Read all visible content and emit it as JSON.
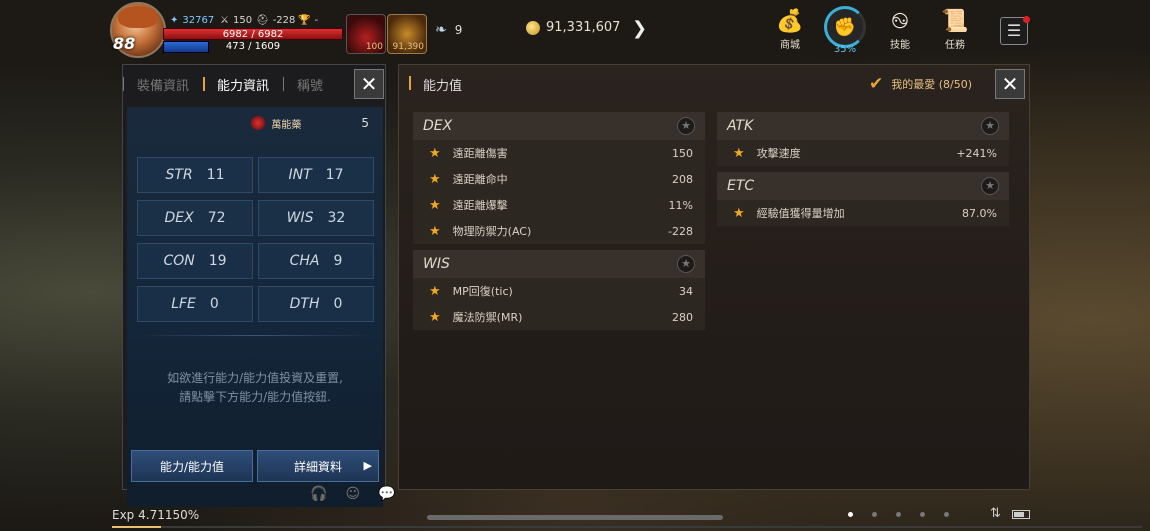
{
  "hud": {
    "level": "88",
    "wing_power": "32767",
    "stat_b": "150",
    "stat_c": "-228",
    "stat_d": "-",
    "hp": "6982 / 6982",
    "mp": "473 / 1609",
    "potion_count": "100",
    "feather_count": "91,390",
    "wing_count": "9",
    "gold": "91,331,607",
    "shop_label": "商城",
    "ring_percent": "35%",
    "skill_label": "技能",
    "quest_label": "任務"
  },
  "left_panel": {
    "tabs": [
      "裝備資訊",
      "能力資訊",
      "稱號"
    ],
    "elixir_label": "萬能藥",
    "elixir_count": "5",
    "stats": [
      {
        "name": "STR",
        "value": "11"
      },
      {
        "name": "INT",
        "value": "17"
      },
      {
        "name": "DEX",
        "value": "72"
      },
      {
        "name": "WIS",
        "value": "32"
      },
      {
        "name": "CON",
        "value": "19"
      },
      {
        "name": "CHA",
        "value": "9"
      },
      {
        "name": "LFE",
        "value": "0"
      },
      {
        "name": "DTH",
        "value": "0"
      }
    ],
    "hint_line1": "如欲進行能力/能力值投資及重置,",
    "hint_line2": "請點擊下方能力/能力值按鈕.",
    "btn_ability": "能力/能力值",
    "btn_detail": "詳細資料"
  },
  "right_panel": {
    "title": "能力值",
    "favorite": "我的最愛 (8/50)",
    "groups": {
      "dex": {
        "name": "DEX",
        "rows": [
          {
            "label": "遠距離傷害",
            "value": "150"
          },
          {
            "label": "遠距離命中",
            "value": "208"
          },
          {
            "label": "遠距離爆擊",
            "value": "11%"
          },
          {
            "label": "物理防禦力(AC)",
            "value": "-228"
          }
        ]
      },
      "wis": {
        "name": "WIS",
        "rows": [
          {
            "label": "MP回復(tic)",
            "value": "34"
          },
          {
            "label": "魔法防禦(MR)",
            "value": "280"
          }
        ]
      },
      "atk": {
        "name": "ATK",
        "rows": [
          {
            "label": "攻擊速度",
            "value": "+241%"
          }
        ]
      },
      "etc": {
        "name": "ETC",
        "rows": [
          {
            "label": "經驗值獲得量增加",
            "value": "87.0%"
          }
        ]
      }
    }
  },
  "bottom": {
    "exp": "Exp 4.71150%",
    "exp_progress": 0.0471
  },
  "colors": {
    "accent": "#e8a23a",
    "star": "#f0a820",
    "hp": "#e03030",
    "mp": "#2a6ad8"
  }
}
